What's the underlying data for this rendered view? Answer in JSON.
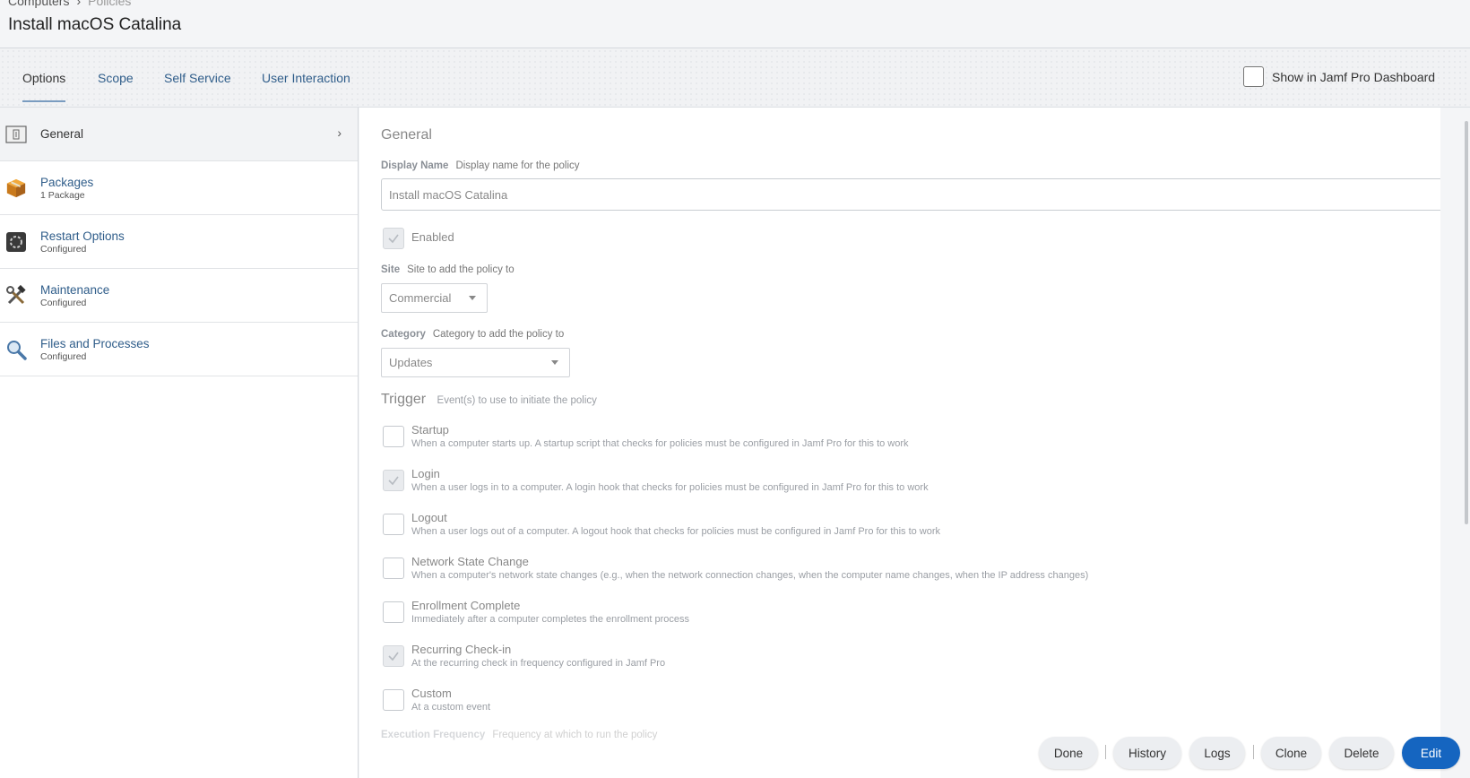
{
  "breadcrumb": {
    "parent": "Computers",
    "separator": "›",
    "current": "Policies"
  },
  "page_title": "Install macOS Catalina",
  "tabs": [
    {
      "label": "Options"
    },
    {
      "label": "Scope"
    },
    {
      "label": "Self Service"
    },
    {
      "label": "User Interaction"
    }
  ],
  "dashboard_toggle": {
    "label": "Show in Jamf Pro Dashboard"
  },
  "sidebar": {
    "items": [
      {
        "label": "General",
        "sub": ""
      },
      {
        "label": "Packages",
        "sub": "1 Package"
      },
      {
        "label": "Restart Options",
        "sub": "Configured"
      },
      {
        "label": "Maintenance",
        "sub": "Configured"
      },
      {
        "label": "Files and Processes",
        "sub": "Configured"
      }
    ]
  },
  "general": {
    "title": "General",
    "display_name": {
      "label": "Display Name",
      "hint": "Display name for the policy",
      "value": "Install macOS Catalina"
    },
    "enabled": {
      "label": "Enabled",
      "checked": true
    },
    "site": {
      "label": "Site",
      "hint": "Site to add the policy to",
      "value": "Commercial"
    },
    "category": {
      "label": "Category",
      "hint": "Category to add the policy to",
      "value": "Updates"
    },
    "trigger": {
      "title": "Trigger",
      "hint": "Event(s) to use to initiate the policy",
      "items": [
        {
          "label": "Startup",
          "desc": "When a computer starts up. A startup script that checks for policies must be configured in Jamf Pro for this to work",
          "checked": false
        },
        {
          "label": "Login",
          "desc": "When a user logs in to a computer. A login hook that checks for policies must be configured in Jamf Pro for this to work",
          "checked": true
        },
        {
          "label": "Logout",
          "desc": "When a user logs out of a computer. A logout hook that checks for policies must be configured in Jamf Pro for this to work",
          "checked": false
        },
        {
          "label": "Network State Change",
          "desc": "When a computer's network state changes (e.g., when the network connection changes, when the computer name changes, when the IP address changes)",
          "checked": false
        },
        {
          "label": "Enrollment Complete",
          "desc": "Immediately after a computer completes the enrollment process",
          "checked": false
        },
        {
          "label": "Recurring Check-in",
          "desc": "At the recurring check in frequency configured in Jamf Pro",
          "checked": true
        },
        {
          "label": "Custom",
          "desc": "At a custom event",
          "checked": false
        }
      ]
    },
    "execution_frequency": {
      "label": "Execution Frequency",
      "hint": "Frequency at which to run the policy"
    }
  },
  "footer": {
    "done": "Done",
    "history": "History",
    "logs": "Logs",
    "clone": "Clone",
    "delete": "Delete",
    "edit": "Edit"
  },
  "colors": {
    "link": "#2f5d8a",
    "primary_button": "#1565c0"
  }
}
